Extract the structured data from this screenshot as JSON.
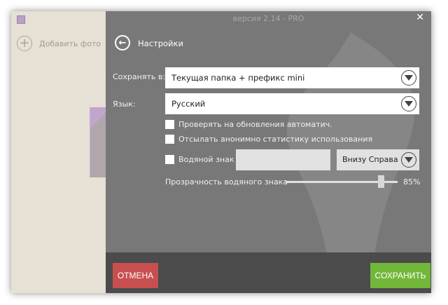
{
  "window": {
    "version": "версия 2.14 - PRO"
  },
  "sidebar": {
    "add_photo": "Добавить фото"
  },
  "header": {
    "title": "Настройки"
  },
  "settings": {
    "save_to_label": "Сохранять в:",
    "save_to_value": "Текущая папка + префикс mini",
    "language_label": "Язык:",
    "language_value": "Русский",
    "check_updates": "Проверять на обновления автоматич.",
    "send_stats": "Отсылать анонимно статистику использования",
    "watermark_label": "Водяной знак",
    "watermark_text": "",
    "watermark_position": "Внизу Справа",
    "opacity_label": "Прозрачность водяного знака",
    "opacity_value": "85%",
    "opacity_percent": 85
  },
  "footer": {
    "cancel": "ОТМЕНА",
    "save": "СОХРАНИТЬ"
  },
  "colors": {
    "cancel": "#c84f4f",
    "save": "#72b73a"
  }
}
